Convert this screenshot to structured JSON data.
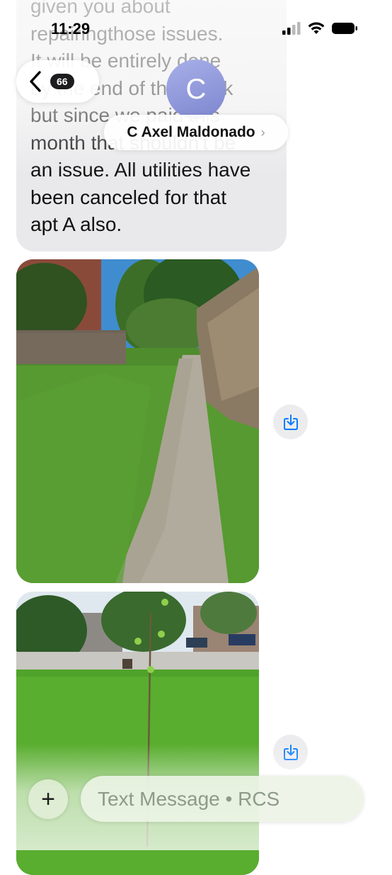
{
  "status_bar": {
    "time": "11:29"
  },
  "header": {
    "back_count": "66",
    "contact_initial": "C",
    "contact_name": "C Axel Maldonado",
    "chevron": "›"
  },
  "message": {
    "lines": [
      "given you about",
      "repairingthose issues.",
      "It will be entirely done",
      "by the end of this week",
      "but since we paid this",
      "month that shouldn't be",
      "an issue. All utilities have",
      "been canceled for that",
      "apt A also."
    ]
  },
  "photos": [
    {
      "description_icon": "image-attachment"
    },
    {
      "description_icon": "image-attachment"
    }
  ],
  "compose": {
    "plus_label": "+",
    "placeholder": "Text Message • RCS"
  },
  "colors": {
    "bubble_bg": "#e9e9eb",
    "accent": "#0a7cff",
    "compose_bg": "#ecf4e6"
  }
}
